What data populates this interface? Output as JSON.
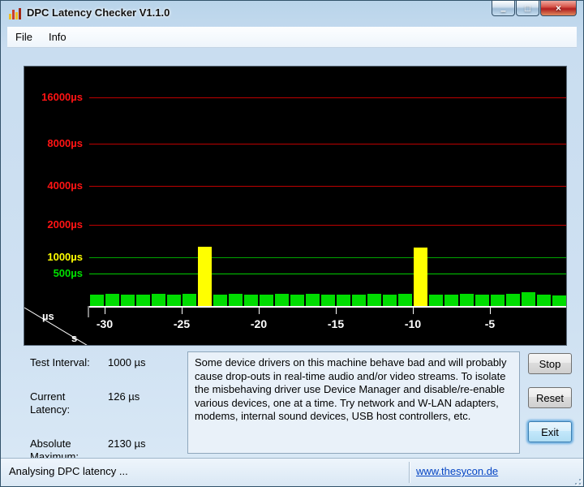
{
  "window": {
    "title": "DPC Latency Checker V1.1.0",
    "controls": [
      {
        "name": "minimize",
        "glyph": "–"
      },
      {
        "name": "maximize",
        "glyph": "□"
      },
      {
        "name": "close",
        "glyph": "×"
      }
    ],
    "app_icon": "bar-chart-icon"
  },
  "menu": {
    "items": [
      "File",
      "Info"
    ]
  },
  "chart_data": {
    "type": "bar",
    "title": "",
    "ylabel": "µs",
    "xlabel": "s",
    "x_ticks": [
      -30,
      -25,
      -20,
      -15,
      -10,
      -5
    ],
    "x_range": [
      -31,
      0
    ],
    "y_scale": "doubling (500,1000,2000,4000,8000,16000 µs)",
    "grid": true,
    "y_gridlines": [
      {
        "value": 16000,
        "label": "16000µs",
        "label_color": "#ff1414",
        "line_color": "#be0000"
      },
      {
        "value": 8000,
        "label": "8000µs",
        "label_color": "#ff1414",
        "line_color": "#be0000"
      },
      {
        "value": 4000,
        "label": "4000µs",
        "label_color": "#ff1414",
        "line_color": "#be0000"
      },
      {
        "value": 2000,
        "label": "2000µs",
        "label_color": "#ff1414",
        "line_color": "#be0000"
      },
      {
        "value": 1000,
        "label": "1000µs",
        "label_color": "#ffff00",
        "line_color": "#00a400"
      },
      {
        "value": 500,
        "label": "500µs",
        "label_color": "#00e000",
        "line_color": "#00cc00"
      }
    ],
    "x": [
      -31,
      -30,
      -29,
      -28,
      -27,
      -26,
      -25,
      -24,
      -23,
      -22,
      -21,
      -20,
      -19,
      -18,
      -17,
      -16,
      -15,
      -14,
      -13,
      -12,
      -11,
      -10,
      -9,
      -8,
      -7,
      -6,
      -5,
      -4,
      -3,
      -2,
      -1
    ],
    "values": [
      176,
      184,
      172,
      180,
      188,
      174,
      182,
      1320,
      178,
      186,
      172,
      180,
      190,
      176,
      184,
      170,
      178,
      174,
      182,
      178,
      186,
      1300,
      180,
      174,
      186,
      170,
      178,
      184,
      212,
      176,
      168
    ],
    "colors": {
      "bar_normal": "#00dc00",
      "bar_spike": "#ffff00",
      "spike_threshold_us": 1000
    }
  },
  "stats": [
    {
      "label": "Test Interval:",
      "value": "1000 µs"
    },
    {
      "label": "Current Latency:",
      "value": "126 µs"
    },
    {
      "label": "Absolute Maximum:",
      "value": "2130 µs"
    }
  ],
  "message": "Some device drivers on this machine behave bad and will probably cause drop-outs in real-time audio and/or video streams. To isolate the misbehaving driver use Device Manager and disable/re-enable various devices, one at a time. Try network and W-LAN adapters, modems, internal sound devices, USB host controllers, etc.",
  "action_buttons": [
    {
      "label": "Stop",
      "focused": false
    },
    {
      "label": "Reset",
      "focused": false
    },
    {
      "label": "Exit",
      "focused": true
    }
  ],
  "status_bar": {
    "text": "Analysing DPC latency ...",
    "link": "www.thesycon.de"
  }
}
